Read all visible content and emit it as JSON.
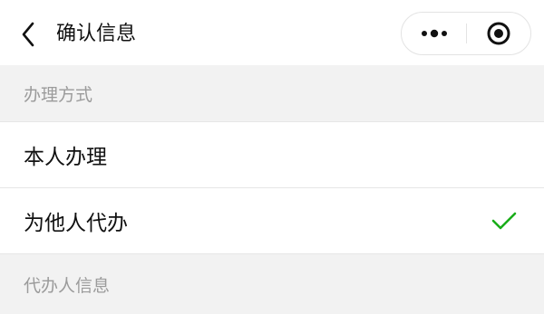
{
  "nav": {
    "title": "确认信息",
    "back_icon": "chevron-left-icon",
    "more_icon": "more-dots-icon",
    "close_icon": "target-close-icon"
  },
  "sections": [
    {
      "header": "办理方式",
      "options": [
        {
          "label": "本人办理",
          "selected": false
        },
        {
          "label": "为他人代办",
          "selected": true
        }
      ]
    },
    {
      "header": "代办人信息"
    }
  ],
  "colors": {
    "check": "#1aad19",
    "section_bg": "#f2f2f2",
    "section_text": "#9b9b9b",
    "divider": "#e6e6e6"
  }
}
